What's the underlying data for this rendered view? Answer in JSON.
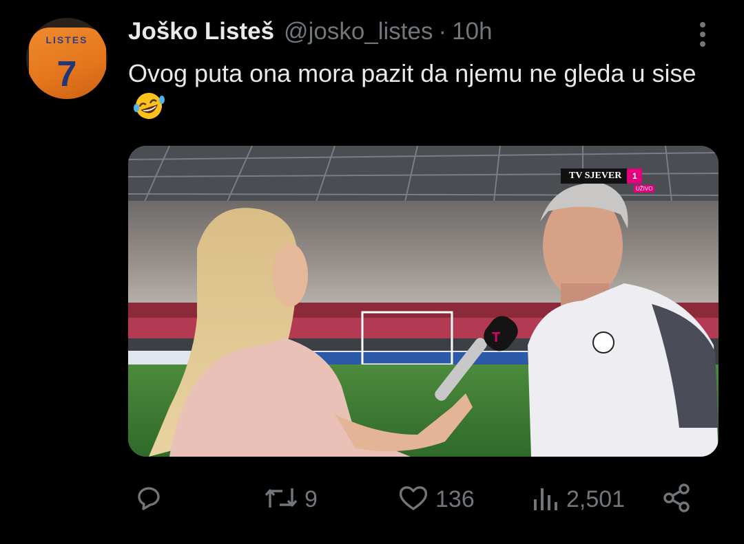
{
  "tweet": {
    "author_display_name": "Joško Listeš",
    "author_handle": "@josko_listes",
    "separator": "·",
    "timestamp": "10h",
    "text": "Ovog puta ona mora pazit da njemu ne gleda u sise",
    "emoji": "rolling-on-the-floor-laughing"
  },
  "avatar": {
    "jersey_name": "LISTES",
    "jersey_number": "7"
  },
  "media": {
    "broadcaster": "TV SJEVER",
    "channel_number": "1",
    "live_label": "UŽIVO"
  },
  "actions": {
    "reply_count": "",
    "retweet_count": "9",
    "like_count": "136",
    "view_count": "2,501"
  },
  "colors": {
    "background": "#000000",
    "text_primary": "#e7e9ea",
    "text_secondary": "#71767b",
    "brand_magenta": "#e4007d"
  }
}
